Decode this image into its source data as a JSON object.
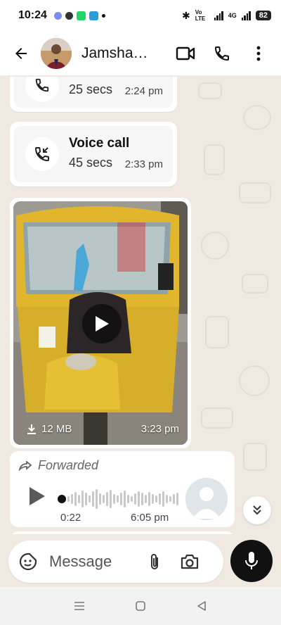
{
  "status_bar": {
    "time": "10:24",
    "network_label": "Vo LTE",
    "network_4g": "4G",
    "battery": "82"
  },
  "header": {
    "contact_name": "Jamsha…"
  },
  "messages": [
    {
      "type": "call",
      "title": "",
      "duration": "25 secs",
      "time": "2:24 pm"
    },
    {
      "type": "call",
      "title": "Voice call",
      "duration": "45 secs",
      "time": "2:33 pm"
    },
    {
      "type": "video",
      "size": "12 MB",
      "time": "3:23 pm"
    },
    {
      "type": "voice",
      "forwarded_label": "Forwarded",
      "duration": "0:22",
      "time": "6:05 pm"
    }
  ],
  "composer": {
    "placeholder": "Message"
  },
  "colors": {
    "chat_background": "#efe9e2",
    "bubble": "#ffffff",
    "mic_button": "#111111"
  },
  "icons": [
    "back-arrow-icon",
    "video-call-icon",
    "phone-icon",
    "more-vert-icon",
    "incoming-call-icon",
    "play-icon",
    "download-icon",
    "forward-icon",
    "double-chevron-down-icon",
    "sticker-icon",
    "attach-icon",
    "camera-icon",
    "mic-icon"
  ]
}
